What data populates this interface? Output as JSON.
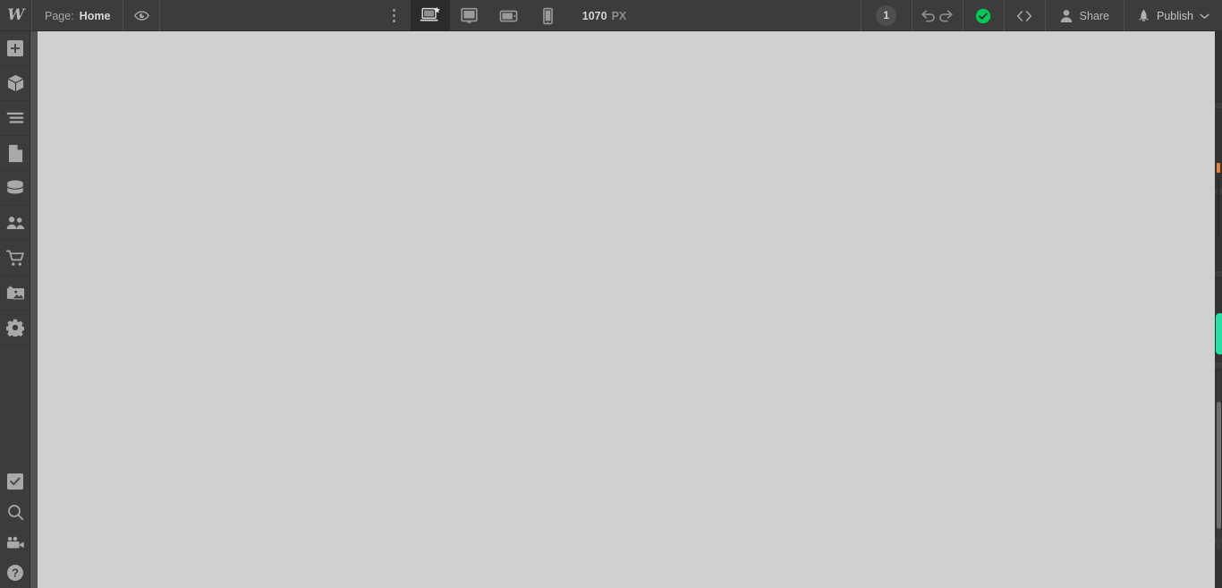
{
  "app": {
    "name": "Webflow Designer",
    "logo_glyph": "W"
  },
  "topbar": {
    "page_label": "Page:",
    "page_name": "Home",
    "preview_icon": "eye-icon",
    "more_menu_icon": "three-dots-vertical-icon",
    "devices": [
      {
        "id": "desktop",
        "icon": "desktop-star-icon",
        "label": "Desktop",
        "active": true
      },
      {
        "id": "tablet",
        "icon": "monitor-icon",
        "label": "Tablet",
        "active": false
      },
      {
        "id": "mobile-landscape",
        "icon": "tablet-landscape-icon",
        "label": "Mobile landscape",
        "active": false
      },
      {
        "id": "mobile-portrait",
        "icon": "mobile-icon",
        "label": "Mobile portrait",
        "active": false
      }
    ],
    "viewport_size": "1070",
    "viewport_unit": "PX",
    "notification_count": "1",
    "undo_icon": "undo-arrow-icon",
    "redo_icon": "redo-arrow-icon",
    "status_icon": "green-check-circle-icon",
    "code_icon": "code-brackets-icon",
    "share_label": "Share",
    "share_icon": "person-icon",
    "publish_label": "Publish",
    "publish_icon": "webflow-rocket-icon",
    "publish_chevron": "chevron-down-icon"
  },
  "sidebar": {
    "items": [
      {
        "id": "add",
        "icon": "plus-square-icon",
        "label": "Add elements"
      },
      {
        "id": "components",
        "icon": "cube-icon",
        "label": "Components"
      },
      {
        "id": "navigator",
        "icon": "navigator-icon",
        "label": "Navigator"
      },
      {
        "id": "pages",
        "icon": "page-icon",
        "label": "Pages"
      },
      {
        "id": "cms",
        "icon": "database-icon",
        "label": "CMS"
      },
      {
        "id": "users",
        "icon": "people-icon",
        "label": "Users"
      },
      {
        "id": "ecommerce",
        "icon": "shopping-cart-icon",
        "label": "Ecommerce"
      },
      {
        "id": "assets",
        "icon": "images-icon",
        "label": "Assets"
      },
      {
        "id": "settings",
        "icon": "gear-icon",
        "label": "Settings"
      }
    ],
    "bottom_items": [
      {
        "id": "audit",
        "icon": "checkbox-check-icon",
        "label": "Audit"
      },
      {
        "id": "search",
        "icon": "magnifier-icon",
        "label": "Search"
      },
      {
        "id": "video",
        "icon": "video-camera-icon",
        "label": "Video tutorials"
      },
      {
        "id": "help",
        "icon": "question-circle-icon",
        "label": "Help"
      }
    ]
  },
  "canvas": {
    "background_color": "#d0d0d0",
    "content": ""
  },
  "right_panel": {
    "teal_tab_color": "#25e0a5",
    "teal_tab_name": "style-panel-handle",
    "scrollbar_name": "vertical-scrollbar",
    "orange_marker_color": "#e8803a"
  },
  "colors": {
    "chrome": "#3c3c3c",
    "chrome_dark": "#2b2b2b",
    "canvas": "#d0d0d0",
    "accent_green": "#00c95a",
    "accent_teal": "#25e0a5",
    "icon": "#a9a9a9",
    "text": "#b9b9b9"
  }
}
